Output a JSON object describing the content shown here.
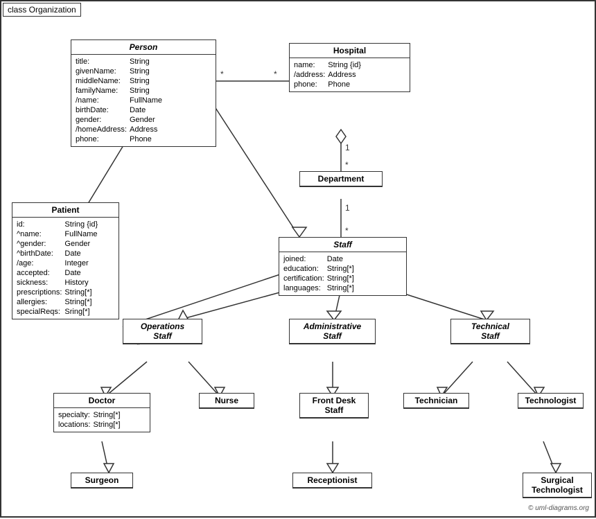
{
  "diagram": {
    "title": "class Organization",
    "classes": {
      "person": {
        "name": "Person",
        "italic": true,
        "attributes": [
          [
            "title:",
            "String"
          ],
          [
            "givenName:",
            "String"
          ],
          [
            "middleName:",
            "String"
          ],
          [
            "familyName:",
            "String"
          ],
          [
            "/name:",
            "FullName"
          ],
          [
            "birthDate:",
            "Date"
          ],
          [
            "gender:",
            "Gender"
          ],
          [
            "/homeAddress:",
            "Address"
          ],
          [
            "phone:",
            "Phone"
          ]
        ]
      },
      "hospital": {
        "name": "Hospital",
        "italic": false,
        "attributes": [
          [
            "name:",
            "String {id}"
          ],
          [
            "/address:",
            "Address"
          ],
          [
            "phone:",
            "Phone"
          ]
        ]
      },
      "department": {
        "name": "Department",
        "italic": false,
        "attributes": []
      },
      "staff": {
        "name": "Staff",
        "italic": true,
        "attributes": [
          [
            "joined:",
            "Date"
          ],
          [
            "education:",
            "String[*]"
          ],
          [
            "certification:",
            "String[*]"
          ],
          [
            "languages:",
            "String[*]"
          ]
        ]
      },
      "patient": {
        "name": "Patient",
        "italic": false,
        "attributes": [
          [
            "id:",
            "String {id}"
          ],
          [
            "^name:",
            "FullName"
          ],
          [
            "^gender:",
            "Gender"
          ],
          [
            "^birthDate:",
            "Date"
          ],
          [
            "/age:",
            "Integer"
          ],
          [
            "accepted:",
            "Date"
          ],
          [
            "sickness:",
            "History"
          ],
          [
            "prescriptions:",
            "String[*]"
          ],
          [
            "allergies:",
            "String[*]"
          ],
          [
            "specialReqs:",
            "Sring[*]"
          ]
        ]
      },
      "operations_staff": {
        "name": "Operations Staff",
        "italic": true,
        "attributes": []
      },
      "administrative_staff": {
        "name": "Administrative Staff",
        "italic": true,
        "attributes": []
      },
      "technical_staff": {
        "name": "Technical Staff",
        "italic": true,
        "attributes": []
      },
      "doctor": {
        "name": "Doctor",
        "italic": false,
        "attributes": [
          [
            "specialty:",
            "String[*]"
          ],
          [
            "locations:",
            "String[*]"
          ]
        ]
      },
      "nurse": {
        "name": "Nurse",
        "italic": false,
        "attributes": []
      },
      "front_desk_staff": {
        "name": "Front Desk Staff",
        "italic": false,
        "attributes": []
      },
      "technician": {
        "name": "Technician",
        "italic": false,
        "attributes": []
      },
      "technologist": {
        "name": "Technologist",
        "italic": false,
        "attributes": []
      },
      "surgeon": {
        "name": "Surgeon",
        "italic": false,
        "attributes": []
      },
      "receptionist": {
        "name": "Receptionist",
        "italic": false,
        "attributes": []
      },
      "surgical_technologist": {
        "name": "Surgical Technologist",
        "italic": false,
        "attributes": []
      }
    },
    "credit": "© uml-diagrams.org"
  }
}
